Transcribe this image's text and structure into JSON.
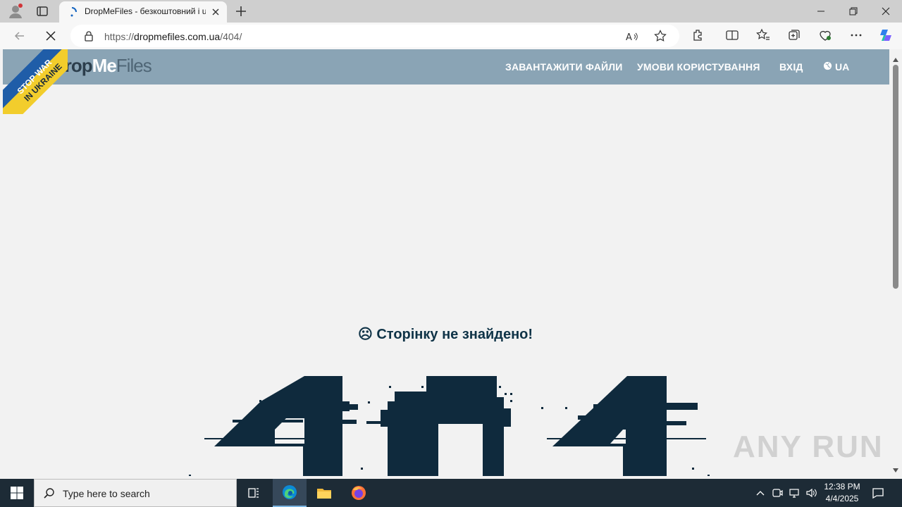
{
  "browser": {
    "tab_title": "DropMeFiles - безкоштовний і u",
    "url_prefix": "https://",
    "url_host": "dropmefiles.com.ua",
    "url_path": "/404/"
  },
  "site": {
    "logo_drop": "Drop",
    "logo_me": "Me",
    "logo_files": "Files",
    "ribbon_line1": "STOP WAR",
    "ribbon_line2": "IN UKRAINE",
    "menu": [
      {
        "label": "ЗАВАНТАЖИТИ ФАЙЛИ"
      },
      {
        "label": "УМОВИ КОРИСТУВАННЯ"
      },
      {
        "label": "ВХІД"
      }
    ],
    "lang": "UA",
    "notfound_text": "☹ Сторінку не знайдено!",
    "art_text": "404",
    "watermark": "ANY RUN"
  },
  "taskbar": {
    "search_placeholder": "Type here to search",
    "time": "12:38 PM",
    "date": "4/4/2025"
  },
  "colors": {
    "header": "#8aa4b5",
    "art": "#0f2a3d",
    "heading": "#0f3347"
  }
}
